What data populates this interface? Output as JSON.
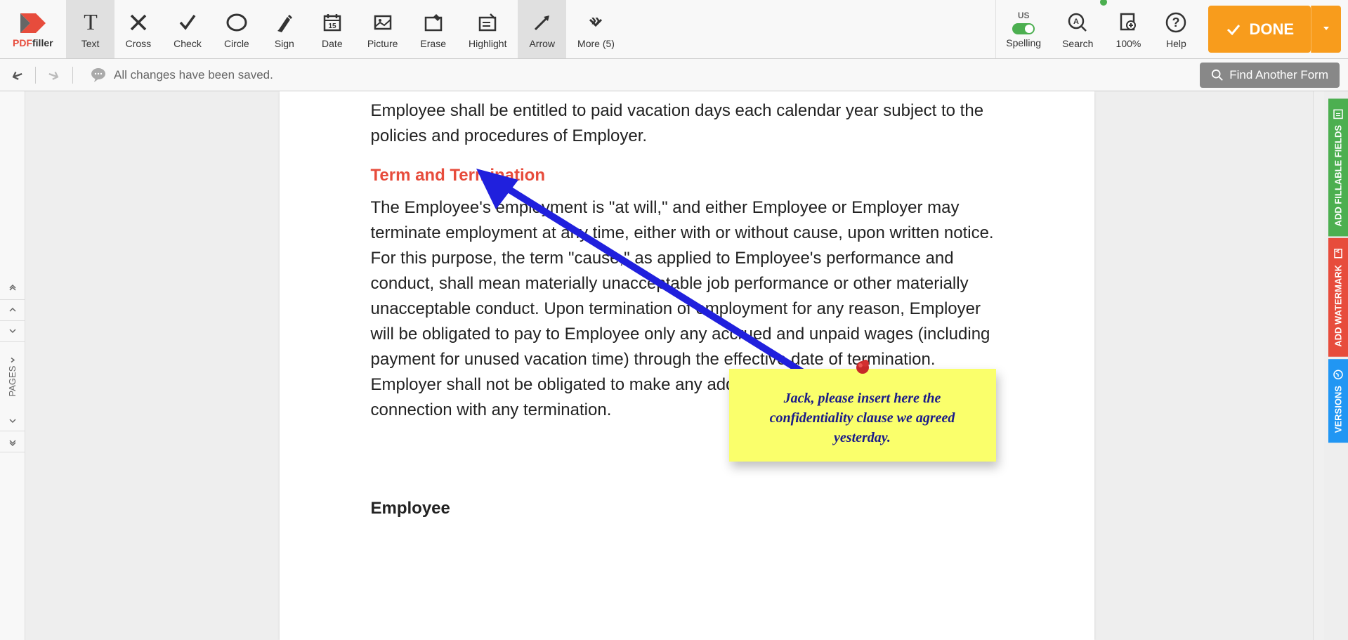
{
  "logo": {
    "brand1": "PDF",
    "brand2": "filler"
  },
  "tools": [
    {
      "label": "Text",
      "active": true
    },
    {
      "label": "Cross"
    },
    {
      "label": "Check"
    },
    {
      "label": "Circle"
    },
    {
      "label": "Sign"
    },
    {
      "label": "Date"
    },
    {
      "label": "Picture"
    },
    {
      "label": "Erase"
    },
    {
      "label": "Highlight"
    },
    {
      "label": "Arrow",
      "active": true
    },
    {
      "label": "More (5)"
    }
  ],
  "spelling": {
    "region": "US",
    "label": "Spelling"
  },
  "search": {
    "label": "Search"
  },
  "zoom": {
    "label": "100%"
  },
  "help": {
    "label": "Help"
  },
  "done": {
    "label": "DONE"
  },
  "subbar": {
    "status": "All changes have been saved.",
    "find": "Find Another Form"
  },
  "pages": {
    "label": "PAGES"
  },
  "doc": {
    "p1": "Employee shall be entitled to paid vacation days each calendar year subject to the policies and procedures of Employer.",
    "h1": "Term and Termination",
    "p2": "The Employee's employment is \"at will,\" and either Employee or Employer may terminate employment at any time, either with or without cause, upon written notice. For this purpose, the term \"cause,\" as applied to Employee's performance and conduct, shall mean materially unacceptable job performance or other materially unacceptable conduct. Upon termination of employment for any reason, Employer will be obligated to pay to Employee only any accrued and unpaid wages (including payment for unused vacation time) through the effective date of termination. Employer shall not be obligated to make any additional payments to Employee in connection with any termination.",
    "h2": "Employee"
  },
  "sticky": {
    "text": "Jack, please insert here the confidentiality clause we agreed yesterday."
  },
  "side": {
    "fields": "ADD FILLABLE FIELDS",
    "watermark": "ADD WATERMARK",
    "versions": "VERSIONS"
  }
}
